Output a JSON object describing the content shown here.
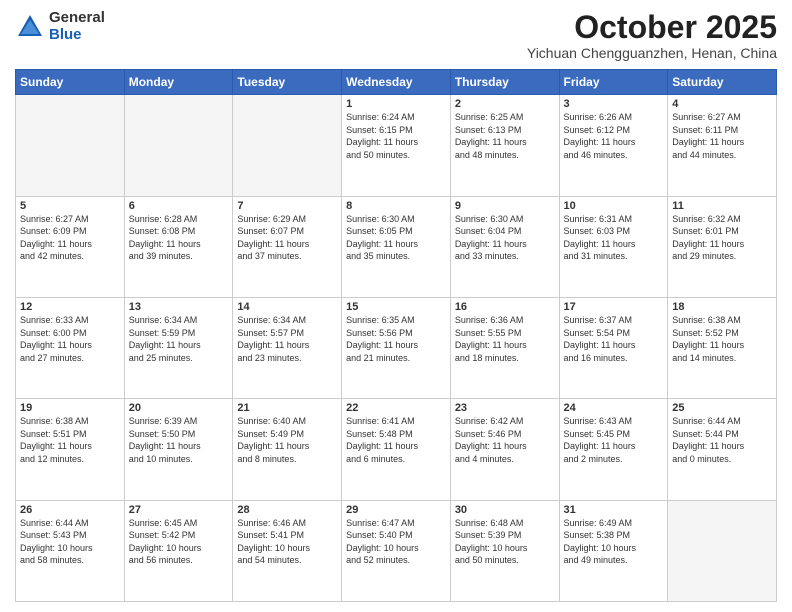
{
  "header": {
    "logo_general": "General",
    "logo_blue": "Blue",
    "month_title": "October 2025",
    "location": "Yichuan Chengguanzhen, Henan, China"
  },
  "weekdays": [
    "Sunday",
    "Monday",
    "Tuesday",
    "Wednesday",
    "Thursday",
    "Friday",
    "Saturday"
  ],
  "weeks": [
    [
      {
        "day": "",
        "info": ""
      },
      {
        "day": "",
        "info": ""
      },
      {
        "day": "",
        "info": ""
      },
      {
        "day": "1",
        "info": "Sunrise: 6:24 AM\nSunset: 6:15 PM\nDaylight: 11 hours\nand 50 minutes."
      },
      {
        "day": "2",
        "info": "Sunrise: 6:25 AM\nSunset: 6:13 PM\nDaylight: 11 hours\nand 48 minutes."
      },
      {
        "day": "3",
        "info": "Sunrise: 6:26 AM\nSunset: 6:12 PM\nDaylight: 11 hours\nand 46 minutes."
      },
      {
        "day": "4",
        "info": "Sunrise: 6:27 AM\nSunset: 6:11 PM\nDaylight: 11 hours\nand 44 minutes."
      }
    ],
    [
      {
        "day": "5",
        "info": "Sunrise: 6:27 AM\nSunset: 6:09 PM\nDaylight: 11 hours\nand 42 minutes."
      },
      {
        "day": "6",
        "info": "Sunrise: 6:28 AM\nSunset: 6:08 PM\nDaylight: 11 hours\nand 39 minutes."
      },
      {
        "day": "7",
        "info": "Sunrise: 6:29 AM\nSunset: 6:07 PM\nDaylight: 11 hours\nand 37 minutes."
      },
      {
        "day": "8",
        "info": "Sunrise: 6:30 AM\nSunset: 6:05 PM\nDaylight: 11 hours\nand 35 minutes."
      },
      {
        "day": "9",
        "info": "Sunrise: 6:30 AM\nSunset: 6:04 PM\nDaylight: 11 hours\nand 33 minutes."
      },
      {
        "day": "10",
        "info": "Sunrise: 6:31 AM\nSunset: 6:03 PM\nDaylight: 11 hours\nand 31 minutes."
      },
      {
        "day": "11",
        "info": "Sunrise: 6:32 AM\nSunset: 6:01 PM\nDaylight: 11 hours\nand 29 minutes."
      }
    ],
    [
      {
        "day": "12",
        "info": "Sunrise: 6:33 AM\nSunset: 6:00 PM\nDaylight: 11 hours\nand 27 minutes."
      },
      {
        "day": "13",
        "info": "Sunrise: 6:34 AM\nSunset: 5:59 PM\nDaylight: 11 hours\nand 25 minutes."
      },
      {
        "day": "14",
        "info": "Sunrise: 6:34 AM\nSunset: 5:57 PM\nDaylight: 11 hours\nand 23 minutes."
      },
      {
        "day": "15",
        "info": "Sunrise: 6:35 AM\nSunset: 5:56 PM\nDaylight: 11 hours\nand 21 minutes."
      },
      {
        "day": "16",
        "info": "Sunrise: 6:36 AM\nSunset: 5:55 PM\nDaylight: 11 hours\nand 18 minutes."
      },
      {
        "day": "17",
        "info": "Sunrise: 6:37 AM\nSunset: 5:54 PM\nDaylight: 11 hours\nand 16 minutes."
      },
      {
        "day": "18",
        "info": "Sunrise: 6:38 AM\nSunset: 5:52 PM\nDaylight: 11 hours\nand 14 minutes."
      }
    ],
    [
      {
        "day": "19",
        "info": "Sunrise: 6:38 AM\nSunset: 5:51 PM\nDaylight: 11 hours\nand 12 minutes."
      },
      {
        "day": "20",
        "info": "Sunrise: 6:39 AM\nSunset: 5:50 PM\nDaylight: 11 hours\nand 10 minutes."
      },
      {
        "day": "21",
        "info": "Sunrise: 6:40 AM\nSunset: 5:49 PM\nDaylight: 11 hours\nand 8 minutes."
      },
      {
        "day": "22",
        "info": "Sunrise: 6:41 AM\nSunset: 5:48 PM\nDaylight: 11 hours\nand 6 minutes."
      },
      {
        "day": "23",
        "info": "Sunrise: 6:42 AM\nSunset: 5:46 PM\nDaylight: 11 hours\nand 4 minutes."
      },
      {
        "day": "24",
        "info": "Sunrise: 6:43 AM\nSunset: 5:45 PM\nDaylight: 11 hours\nand 2 minutes."
      },
      {
        "day": "25",
        "info": "Sunrise: 6:44 AM\nSunset: 5:44 PM\nDaylight: 11 hours\nand 0 minutes."
      }
    ],
    [
      {
        "day": "26",
        "info": "Sunrise: 6:44 AM\nSunset: 5:43 PM\nDaylight: 10 hours\nand 58 minutes."
      },
      {
        "day": "27",
        "info": "Sunrise: 6:45 AM\nSunset: 5:42 PM\nDaylight: 10 hours\nand 56 minutes."
      },
      {
        "day": "28",
        "info": "Sunrise: 6:46 AM\nSunset: 5:41 PM\nDaylight: 10 hours\nand 54 minutes."
      },
      {
        "day": "29",
        "info": "Sunrise: 6:47 AM\nSunset: 5:40 PM\nDaylight: 10 hours\nand 52 minutes."
      },
      {
        "day": "30",
        "info": "Sunrise: 6:48 AM\nSunset: 5:39 PM\nDaylight: 10 hours\nand 50 minutes."
      },
      {
        "day": "31",
        "info": "Sunrise: 6:49 AM\nSunset: 5:38 PM\nDaylight: 10 hours\nand 49 minutes."
      },
      {
        "day": "",
        "info": ""
      }
    ]
  ]
}
